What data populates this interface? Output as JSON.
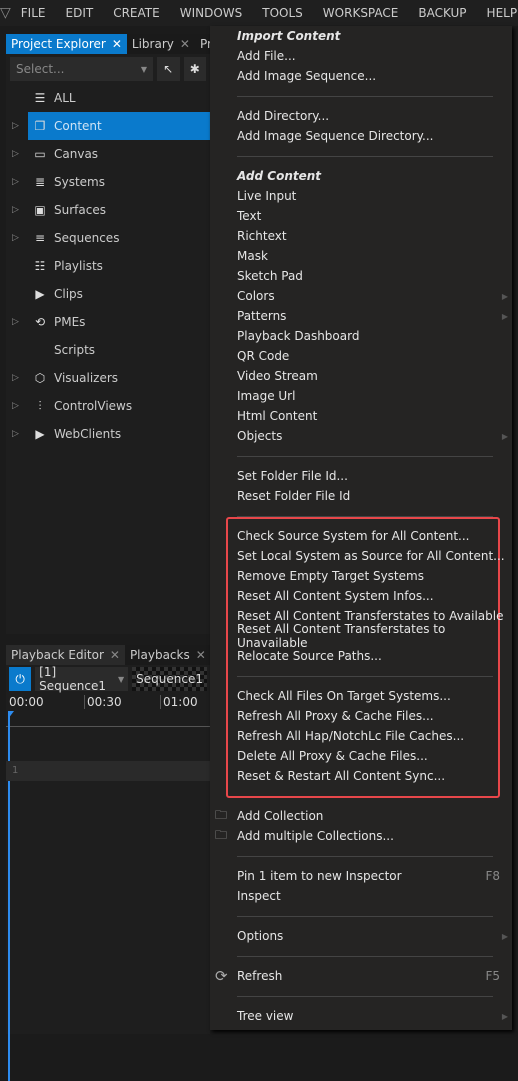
{
  "menubar": {
    "items": [
      "FILE",
      "EDIT",
      "CREATE",
      "WINDOWS",
      "TOOLS",
      "WORKSPACE",
      "BACKUP",
      "HELP"
    ]
  },
  "explorer": {
    "tabs": [
      "Project Explorer",
      "Library",
      "Progr"
    ],
    "select_placeholder": "Select...",
    "tree": [
      {
        "label": "ALL",
        "icon": "database-icon",
        "expandable": false
      },
      {
        "label": "Content",
        "icon": "copy-icon",
        "expandable": true,
        "selected": true
      },
      {
        "label": "Canvas",
        "icon": "canvas-icon",
        "expandable": true
      },
      {
        "label": "Systems",
        "icon": "server-icon",
        "expandable": true
      },
      {
        "label": "Surfaces",
        "icon": "surface-icon",
        "expandable": true
      },
      {
        "label": "Sequences",
        "icon": "sequence-icon",
        "expandable": true
      },
      {
        "label": "Playlists",
        "icon": "playlist-icon",
        "expandable": false
      },
      {
        "label": "Clips",
        "icon": "film-icon",
        "expandable": false
      },
      {
        "label": "PMEs",
        "icon": "loop-icon",
        "expandable": true
      },
      {
        "label": "Scripts",
        "icon": "code-icon",
        "expandable": false
      },
      {
        "label": "Visualizers",
        "icon": "cube-icon",
        "expandable": true
      },
      {
        "label": "ControlViews",
        "icon": "sliders-icon",
        "expandable": true
      },
      {
        "label": "WebClients",
        "icon": "browser-icon",
        "expandable": true
      }
    ]
  },
  "playback": {
    "tabs": [
      "Playback Editor",
      "Playbacks"
    ],
    "sequence_select": "[1] Sequence1",
    "sequence_label": "Sequence1",
    "ruler": [
      "00:00",
      "00:30",
      "01:00"
    ],
    "track": "1"
  },
  "context_menu": {
    "accent": "#e8474a",
    "items": [
      {
        "type": "header",
        "label": "Import Content"
      },
      {
        "label": "Add File..."
      },
      {
        "label": "Add Image Sequence..."
      },
      {
        "type": "sep"
      },
      {
        "label": "Add Directory..."
      },
      {
        "label": "Add Image Sequence Directory..."
      },
      {
        "type": "sep"
      },
      {
        "type": "header",
        "label": "Add Content"
      },
      {
        "label": "Live Input"
      },
      {
        "label": "Text"
      },
      {
        "label": "Richtext"
      },
      {
        "label": "Mask"
      },
      {
        "label": "Sketch Pad"
      },
      {
        "label": "Colors",
        "submenu": true
      },
      {
        "label": "Patterns",
        "submenu": true
      },
      {
        "label": "Playback Dashboard"
      },
      {
        "label": "QR Code"
      },
      {
        "label": "Video Stream"
      },
      {
        "label": "Image Url"
      },
      {
        "label": "Html Content"
      },
      {
        "label": "Objects",
        "submenu": true
      },
      {
        "type": "sep"
      },
      {
        "label": "Set Folder File Id..."
      },
      {
        "label": "Reset Folder File Id"
      },
      {
        "type": "sep"
      },
      {
        "label": "Check Source System for All Content..."
      },
      {
        "label": "Set Local System as Source for All Content..."
      },
      {
        "label": "Remove Empty Target Systems"
      },
      {
        "label": "Reset All Content System Infos..."
      },
      {
        "label": "Reset All Content Transferstates to Available"
      },
      {
        "label": "Reset All Content Transferstates to Unavailable"
      },
      {
        "label": "Relocate Source Paths..."
      },
      {
        "type": "sep"
      },
      {
        "label": "Check All Files On Target Systems..."
      },
      {
        "label": "Refresh All Proxy & Cache Files..."
      },
      {
        "label": "Refresh All Hap/NotchLc File Caches..."
      },
      {
        "label": "Delete All Proxy & Cache Files..."
      },
      {
        "label": "Reset & Restart All Content Sync..."
      },
      {
        "type": "sep",
        "hidden": true
      },
      {
        "label": "Add Collection",
        "icon": "folder-star-icon"
      },
      {
        "label": "Add multiple Collections...",
        "icon": "folder-star-icon"
      },
      {
        "type": "sep"
      },
      {
        "label": "Pin 1 item to new Inspector",
        "shortcut": "F8"
      },
      {
        "label": "Inspect"
      },
      {
        "type": "sep"
      },
      {
        "label": "Options",
        "submenu": true
      },
      {
        "type": "sep"
      },
      {
        "label": "Refresh",
        "shortcut": "F5",
        "icon": "refresh-icon"
      },
      {
        "type": "sep"
      },
      {
        "label": "Tree view",
        "submenu": true
      }
    ]
  }
}
